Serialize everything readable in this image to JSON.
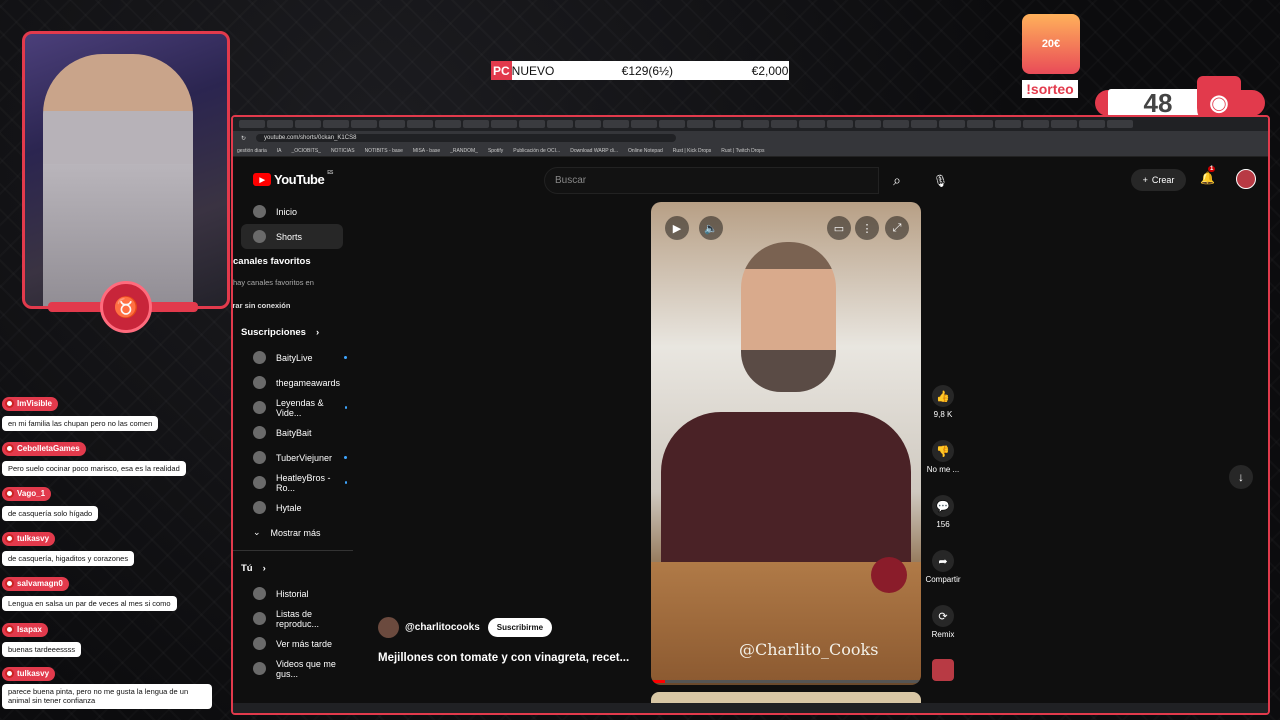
{
  "ticker": {
    "tag": "PC",
    "label": "NUEVO",
    "price": "€129(6½)",
    "total": "€2,000"
  },
  "overlay": {
    "sorteo": "!sorteo",
    "counter": "48",
    "badge_top": "20€"
  },
  "browser": {
    "url": "youtube.com/shorts/0ckan_K1CS8",
    "bookmarks": [
      "gestión diaria",
      "IA",
      "_OCIOBITS_",
      "NOTICIAS",
      "NOTIBITS - base",
      "MISA - base",
      "_RANDOM_",
      "Spotify",
      "Publicación de OCI...",
      "Download WARP di...",
      "Online Notepad",
      "Rust | Kick Drops",
      "Rust | Twitch Drops"
    ]
  },
  "youtube": {
    "logo": "YouTube",
    "region": "ES",
    "search_placeholder": "Buscar",
    "create": "Crear",
    "notif_count": "1",
    "sidebar": {
      "inicio": "Inicio",
      "shorts": "Shorts",
      "canales_favoritos": "canales favoritos",
      "no_favs": "hay canales favoritos en",
      "offline": "Mostrar sin conexión",
      "suscripciones": "Suscripciones",
      "subs": [
        "BaityLive",
        "thegameawards",
        "Leyendas & Vide...",
        "BaityBait",
        "TuberViejuner",
        "HeatleyBros - Ro...",
        "Hytale"
      ],
      "mostrar_mas": "Mostrar más",
      "tu": "Tú",
      "historial": "Historial",
      "listas": "Listas de reproduc...",
      "ver_mas_tarde": "Ver más tarde",
      "videos_gustan": "Videos que me gus..."
    },
    "short": {
      "channel": "@charlitocooks",
      "subscribe": "Suscribirme",
      "title": "Mejillones con tomate y con vinagreta, recet...",
      "watermark": "@Charlito_Cooks",
      "likes": "9,8 K",
      "dislike": "No me ...",
      "comments": "156",
      "share": "Compartir",
      "remix": "Remix",
      "progress": 0.05
    }
  },
  "chat": [
    {
      "user": "ImVisible",
      "text": "en mi familia las chupan pero no las comen"
    },
    {
      "user": "CebolletaGames",
      "text": "Pero suelo cocinar poco marisco, esa es la realidad"
    },
    {
      "user": "Vago_1",
      "text": "de casquería solo hígado"
    },
    {
      "user": "tulkasvy",
      "text": "de casquería, higaditos y corazones"
    },
    {
      "user": "salvamagn0",
      "text": "Lengua en salsa un par de veces al mes si como"
    },
    {
      "user": "Isapax",
      "text": "buenas tardeeessss"
    },
    {
      "user": "tulkasvy",
      "text": "parece buena pinta, pero no me gusta la lengua de un animal sin tener confianza"
    }
  ]
}
